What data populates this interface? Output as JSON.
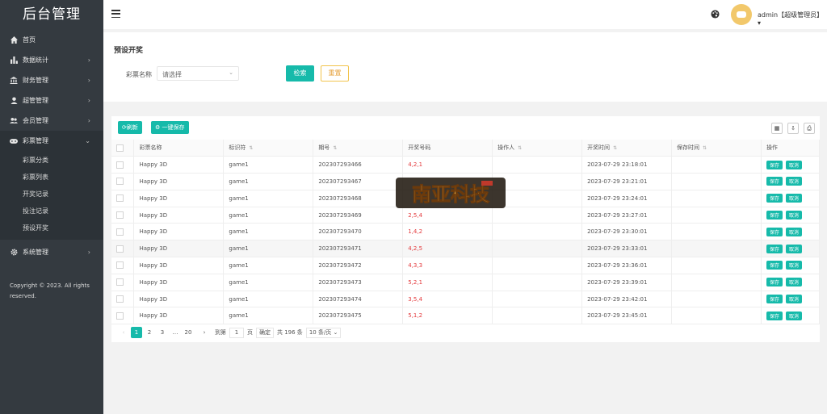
{
  "sidebar": {
    "logo": "后台管理",
    "items": [
      {
        "label": "首页",
        "icon": "home-icon",
        "has_arrow": false
      },
      {
        "label": "数据统计",
        "icon": "bar-chart-icon",
        "has_arrow": true
      },
      {
        "label": "财务管理",
        "icon": "bank-icon",
        "has_arrow": true
      },
      {
        "label": "超管管理",
        "icon": "user-icon",
        "has_arrow": true
      },
      {
        "label": "会员管理",
        "icon": "users-icon",
        "has_arrow": true
      },
      {
        "label": "彩票管理",
        "icon": "gamepad-icon",
        "has_arrow": true,
        "expanded": true
      }
    ],
    "sub_items": [
      "彩票分类",
      "彩票列表",
      "开奖记录",
      "投注记录",
      "预设开奖"
    ],
    "system": {
      "label": "系统管理",
      "icon": "gear-icon"
    },
    "copyright_1": "Copyright © 2023. All rights",
    "copyright_2": "reserved."
  },
  "topbar": {
    "user": "admin【超级管理员】",
    "user_caret": "▾"
  },
  "search": {
    "title": "预设开奖",
    "label": "彩票名称",
    "select_value": "请选择",
    "search_button": "检索",
    "reset_button": "重置"
  },
  "toolbar": {
    "refresh": "刷新",
    "save_all": "一键保存"
  },
  "table": {
    "headers": [
      "彩票名称",
      "标识符",
      "期号",
      "开奖号码",
      "操作人",
      "开奖时间",
      "保存时间",
      "操作"
    ],
    "rows": [
      {
        "name": "Happy 3D",
        "key": "game1",
        "issue": "202307293466",
        "number": "4,2,1",
        "operator": "",
        "open_time": "2023-07-29 23:18:01",
        "save_time": ""
      },
      {
        "name": "Happy 3D",
        "key": "game1",
        "issue": "202307293467",
        "number": "",
        "operator": "",
        "open_time": "2023-07-29 23:21:01",
        "save_time": ""
      },
      {
        "name": "Happy 3D",
        "key": "game1",
        "issue": "202307293468",
        "number": "",
        "operator": "",
        "open_time": "2023-07-29 23:24:01",
        "save_time": ""
      },
      {
        "name": "Happy 3D",
        "key": "game1",
        "issue": "202307293469",
        "number": "2,5,4",
        "operator": "",
        "open_time": "2023-07-29 23:27:01",
        "save_time": ""
      },
      {
        "name": "Happy 3D",
        "key": "game1",
        "issue": "202307293470",
        "number": "1,4,2",
        "operator": "",
        "open_time": "2023-07-29 23:30:01",
        "save_time": ""
      },
      {
        "name": "Happy 3D",
        "key": "game1",
        "issue": "202307293471",
        "number": "4,2,5",
        "operator": "",
        "open_time": "2023-07-29 23:33:01",
        "save_time": ""
      },
      {
        "name": "Happy 3D",
        "key": "game1",
        "issue": "202307293472",
        "number": "4,3,3",
        "operator": "",
        "open_time": "2023-07-29 23:36:01",
        "save_time": ""
      },
      {
        "name": "Happy 3D",
        "key": "game1",
        "issue": "202307293473",
        "number": "5,2,1",
        "operator": "",
        "open_time": "2023-07-29 23:39:01",
        "save_time": ""
      },
      {
        "name": "Happy 3D",
        "key": "game1",
        "issue": "202307293474",
        "number": "3,5,4",
        "operator": "",
        "open_time": "2023-07-29 23:42:01",
        "save_time": ""
      },
      {
        "name": "Happy 3D",
        "key": "game1",
        "issue": "202307293475",
        "number": "5,1,2",
        "operator": "",
        "open_time": "2023-07-29 23:45:01",
        "save_time": ""
      }
    ],
    "save_btn": "保存",
    "cancel_btn": "取消"
  },
  "pager": {
    "prev": "‹",
    "pages": [
      "1",
      "2",
      "3"
    ],
    "ellipsis": "…",
    "last": "20",
    "next": "›",
    "goto_label": "到第",
    "goto_value": "1",
    "page_unit": "页",
    "confirm": "确定",
    "total": "共 196 条",
    "limit": "10 条/页"
  },
  "watermark": "南亚科技",
  "colors": {
    "accent": "#16baaa",
    "sidebar": "#343a40",
    "number_red": "#e4393c",
    "reset_border": "#f2c44d"
  }
}
